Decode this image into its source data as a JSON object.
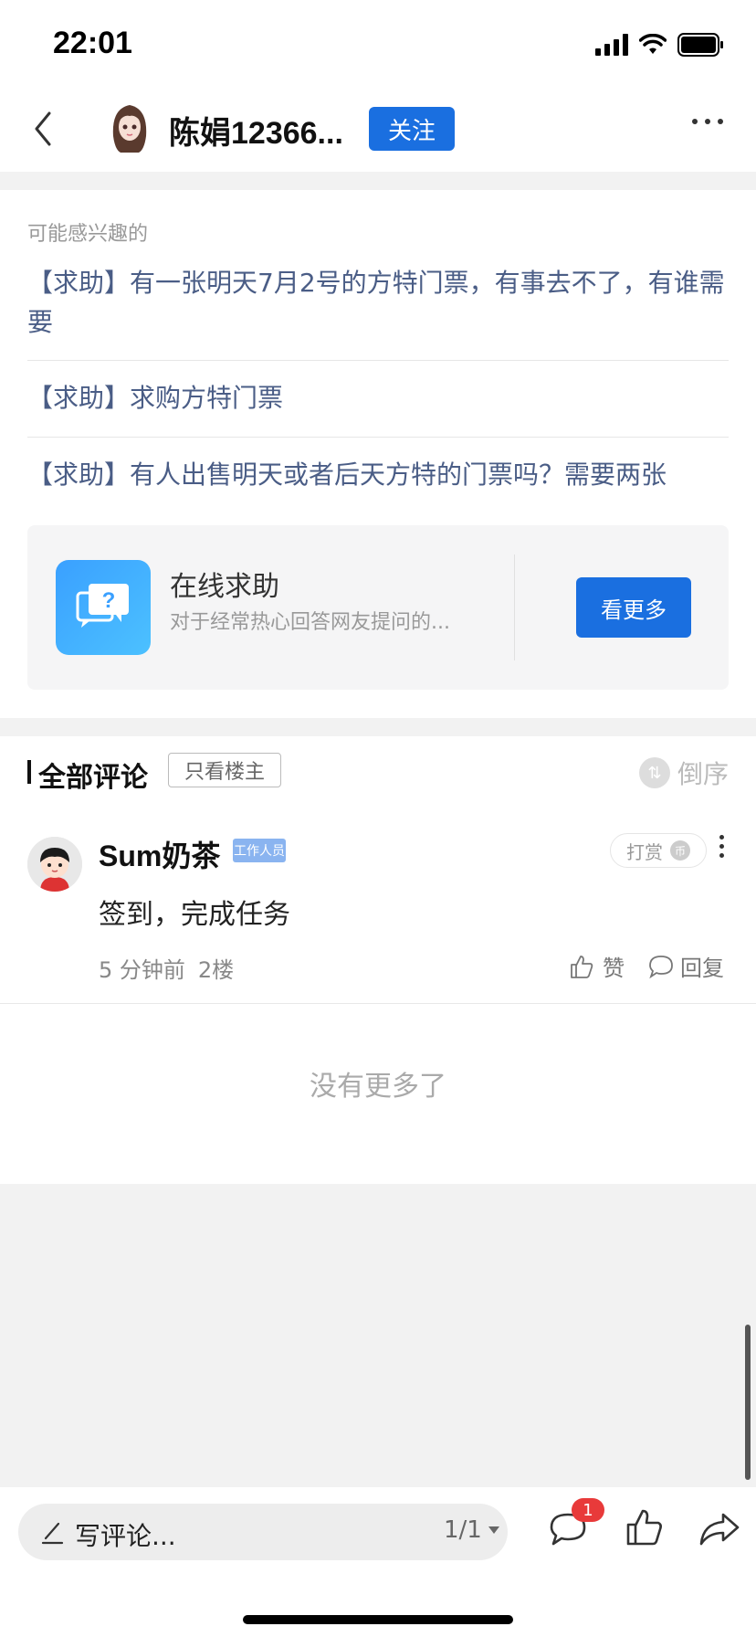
{
  "status_bar": {
    "time": "22:01"
  },
  "header": {
    "user_name": "陈娟12366...",
    "follow_label": "关注"
  },
  "related": {
    "section_title": "可能感兴趣的",
    "items": [
      "【求助】有一张明天7月2号的方特门票，有事去不了，有谁需要",
      "【求助】求购方特门票",
      "【求助】有人出售明天或者后天方特的门票吗？需要两张"
    ],
    "promo": {
      "title": "在线求助",
      "description": "对于经常热心回答网友提问的...",
      "button_label": "看更多",
      "icon": "question-chat-icon"
    }
  },
  "comments": {
    "title": "全部评论",
    "filter_label": "只看楼主",
    "sort_label": "倒序",
    "items": [
      {
        "author": "Sum奶茶",
        "badge": "工作人员",
        "tip_label": "打赏",
        "coin_glyph": "币",
        "body": "签到，完成任务",
        "time": "5 分钟前",
        "floor": "2楼",
        "like_label": "赞",
        "reply_label": "回复"
      }
    ],
    "no_more": "没有更多了"
  },
  "bottom_bar": {
    "input_placeholder": "写评论...",
    "page_indicator": "1/1",
    "comment_count_badge": "1"
  },
  "colors": {
    "accent": "#1a6fe0",
    "link_text": "#4a5d86",
    "badge_red": "#e83a3a"
  }
}
